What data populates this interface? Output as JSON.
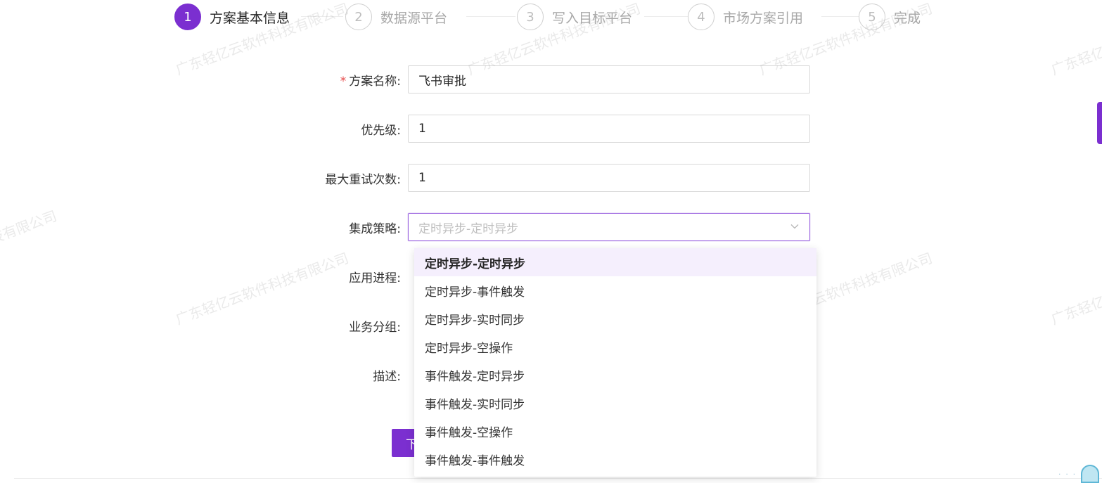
{
  "steps": [
    {
      "num": "1",
      "title": "方案基本信息",
      "active": true
    },
    {
      "num": "2",
      "title": "数据源平台",
      "active": false
    },
    {
      "num": "3",
      "title": "写入目标平台",
      "active": false
    },
    {
      "num": "4",
      "title": "市场方案引用",
      "active": false
    },
    {
      "num": "5",
      "title": "完成",
      "active": false
    }
  ],
  "form": {
    "required_mark": "*",
    "name_label": "方案名称:",
    "name_value": "飞书审批",
    "priority_label": "优先级:",
    "priority_value": "1",
    "retry_label": "最大重试次数:",
    "retry_value": "1",
    "strategy_label": "集成策略:",
    "strategy_placeholder": "定时异步-定时异步",
    "process_label": "应用进程:",
    "group_label": "业务分组:",
    "desc_label": "描述:"
  },
  "strategy_options": [
    "定时异步-定时异步",
    "定时异步-事件触发",
    "定时异步-实时同步",
    "定时异步-空操作",
    "事件触发-定时异步",
    "事件触发-实时同步",
    "事件触发-空操作",
    "事件触发-事件触发"
  ],
  "next_button_label": "下",
  "watermark_text": "广东轻亿云软件科技有限公司",
  "colors": {
    "primary": "#7b2fd0",
    "selected_bg": "#f5effd",
    "required": "#e64b4b"
  }
}
